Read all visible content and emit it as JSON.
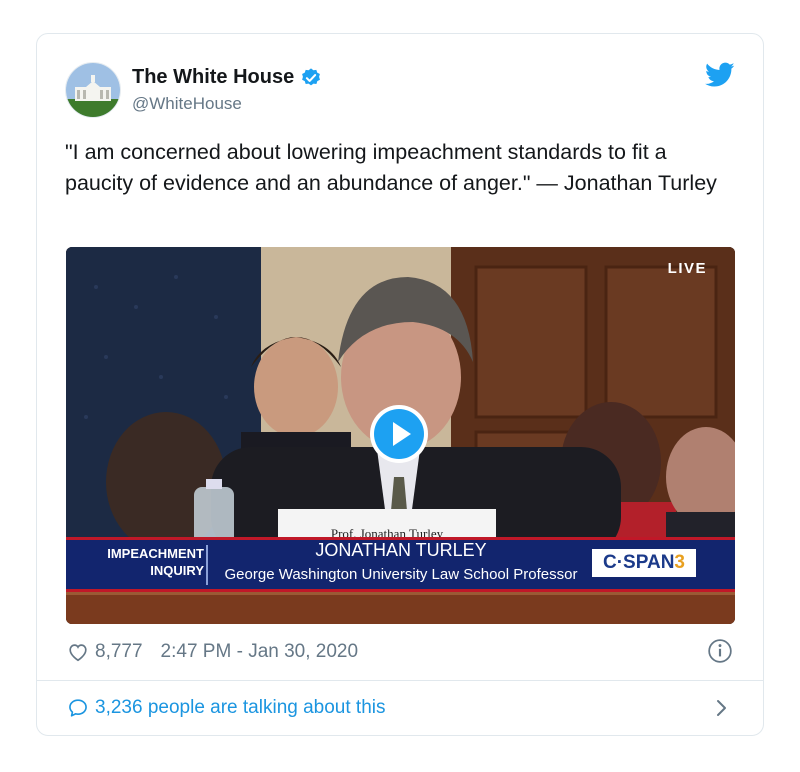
{
  "tweet": {
    "author_name": "The White House",
    "handle": "@WhiteHouse",
    "text": "\"I am concerned about lowering impeachment standards to fit a paucity of evidence and an abundance of anger.\" — Jonathan Turley",
    "likes": "8,777",
    "timestamp": "2:47 PM - Jan 30, 2020",
    "talking": "3,236 people are talking about this"
  },
  "video": {
    "live_label": "LIVE",
    "placard": "Prof. Jonathan Turley",
    "chyron_left_line1": "IMPEACHMENT",
    "chyron_left_line2": "INQUIRY",
    "chyron_name": "JONATHAN TURLEY",
    "chyron_title": "George Washington University Law School Professor",
    "network_text": "C·SPAN",
    "network_number": "3"
  },
  "icons": {
    "verified": "verified-badge-icon",
    "brand": "twitter-bird-icon",
    "like": "heart-icon",
    "info": "info-icon",
    "reply": "comment-icon",
    "chevron": "chevron-right-icon",
    "play": "play-icon"
  },
  "colors": {
    "twitter_blue": "#1da1f2",
    "link_blue": "#1b95e0",
    "muted": "#657786",
    "cspan_blue": "#1b3a8a",
    "chyron_bg": "#12256e"
  }
}
